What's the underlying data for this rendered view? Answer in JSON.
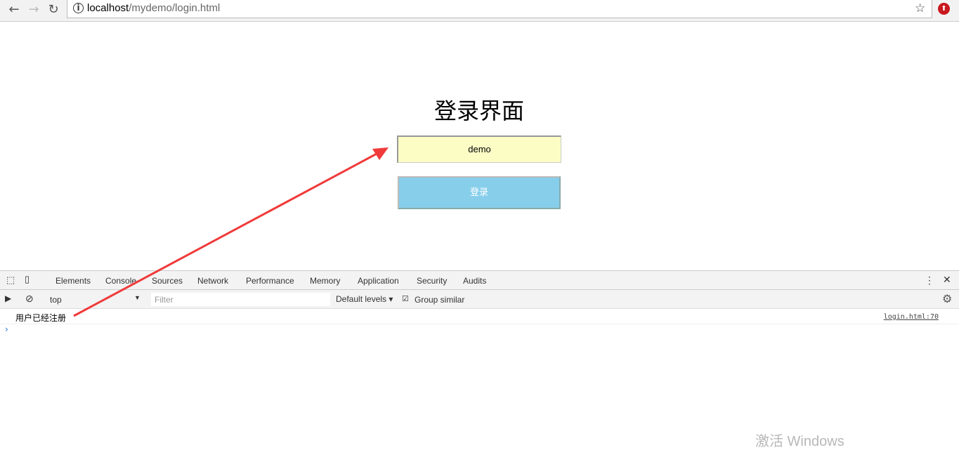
{
  "browser": {
    "url_host": "localhost",
    "url_path": "/mydemo/login.html",
    "back_icon": "back-arrow-icon",
    "forward_icon": "forward-arrow-icon",
    "reload_icon": "reload-icon",
    "bookmark_icon": "star-icon"
  },
  "page": {
    "title": "登录界面",
    "username_value": "demo",
    "login_label": "登录"
  },
  "devtools": {
    "tabs": [
      "Elements",
      "Console",
      "Sources",
      "Network",
      "Performance",
      "Memory",
      "Application",
      "Security",
      "Audits"
    ],
    "active_tab": "Console",
    "context": "top",
    "filter_placeholder": "Filter",
    "levels": "Default levels",
    "group_similar": "Group similar",
    "group_similar_checked": true,
    "messages": [
      {
        "text": "用户已经注册",
        "source": "login.html:70"
      }
    ]
  },
  "watermark": "激活 Windows",
  "annotation_color": "#f03a3a"
}
